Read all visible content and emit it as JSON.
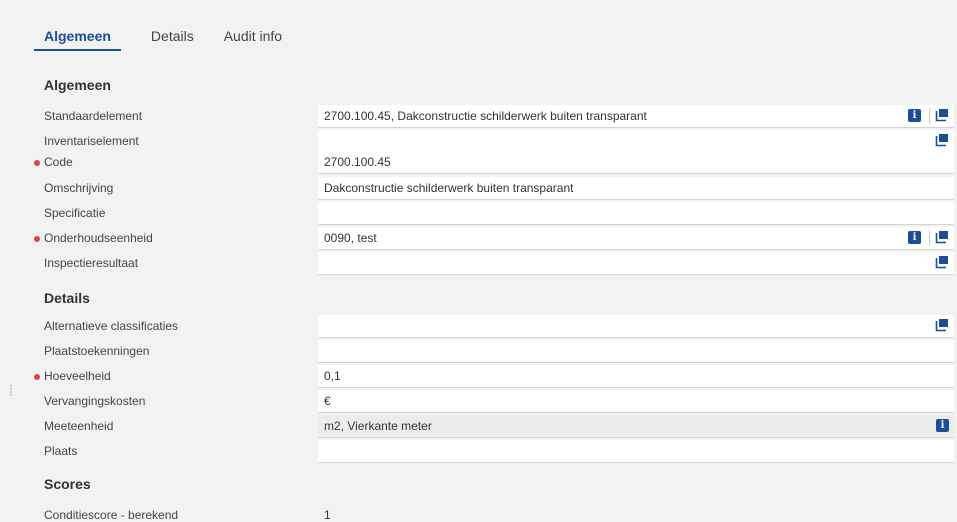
{
  "tabs": [
    {
      "label": "Algemeen",
      "active": true
    },
    {
      "label": "Details",
      "active": false
    },
    {
      "label": "Audit info",
      "active": false
    }
  ],
  "sections": {
    "algemeen": "Algemeen",
    "details": "Details",
    "scores": "Scores"
  },
  "fields": {
    "standaardelement": {
      "label": "Standaardelement",
      "value": "2700.100.45, Dakconstructie schilderwerk buiten transparant"
    },
    "inventariselement": {
      "label": "Inventariselement",
      "value": ""
    },
    "code": {
      "label": "Code",
      "value": "2700.100.45",
      "required": true
    },
    "omschrijving": {
      "label": "Omschrijving",
      "value": "Dakconstructie schilderwerk buiten transparant"
    },
    "specificatie": {
      "label": "Specificatie",
      "value": ""
    },
    "onderhoudseenheid": {
      "label": "Onderhoudseenheid",
      "value": "0090, test",
      "required": true
    },
    "inspectieresultaat": {
      "label": "Inspectieresultaat",
      "value": ""
    },
    "alternatieve_classificaties": {
      "label": "Alternatieve classificaties",
      "value": ""
    },
    "plaatstoekenningen": {
      "label": "Plaatstoekenningen",
      "value": ""
    },
    "hoeveelheid": {
      "label": "Hoeveelheid",
      "value": "0,1",
      "required": true
    },
    "vervangingskosten": {
      "label": "Vervangingskosten",
      "value": "€"
    },
    "meeteenheid": {
      "label": "Meeteenheid",
      "value": "m2, Vierkante meter"
    },
    "plaats": {
      "label": "Plaats",
      "value": ""
    },
    "conditiescore": {
      "label": "Conditiescore - berekend",
      "value": "1"
    }
  },
  "icons": {
    "info": "info-icon",
    "open": "open-record-icon"
  },
  "colors": {
    "accent": "#1a4e9a",
    "required": "#e04040"
  }
}
